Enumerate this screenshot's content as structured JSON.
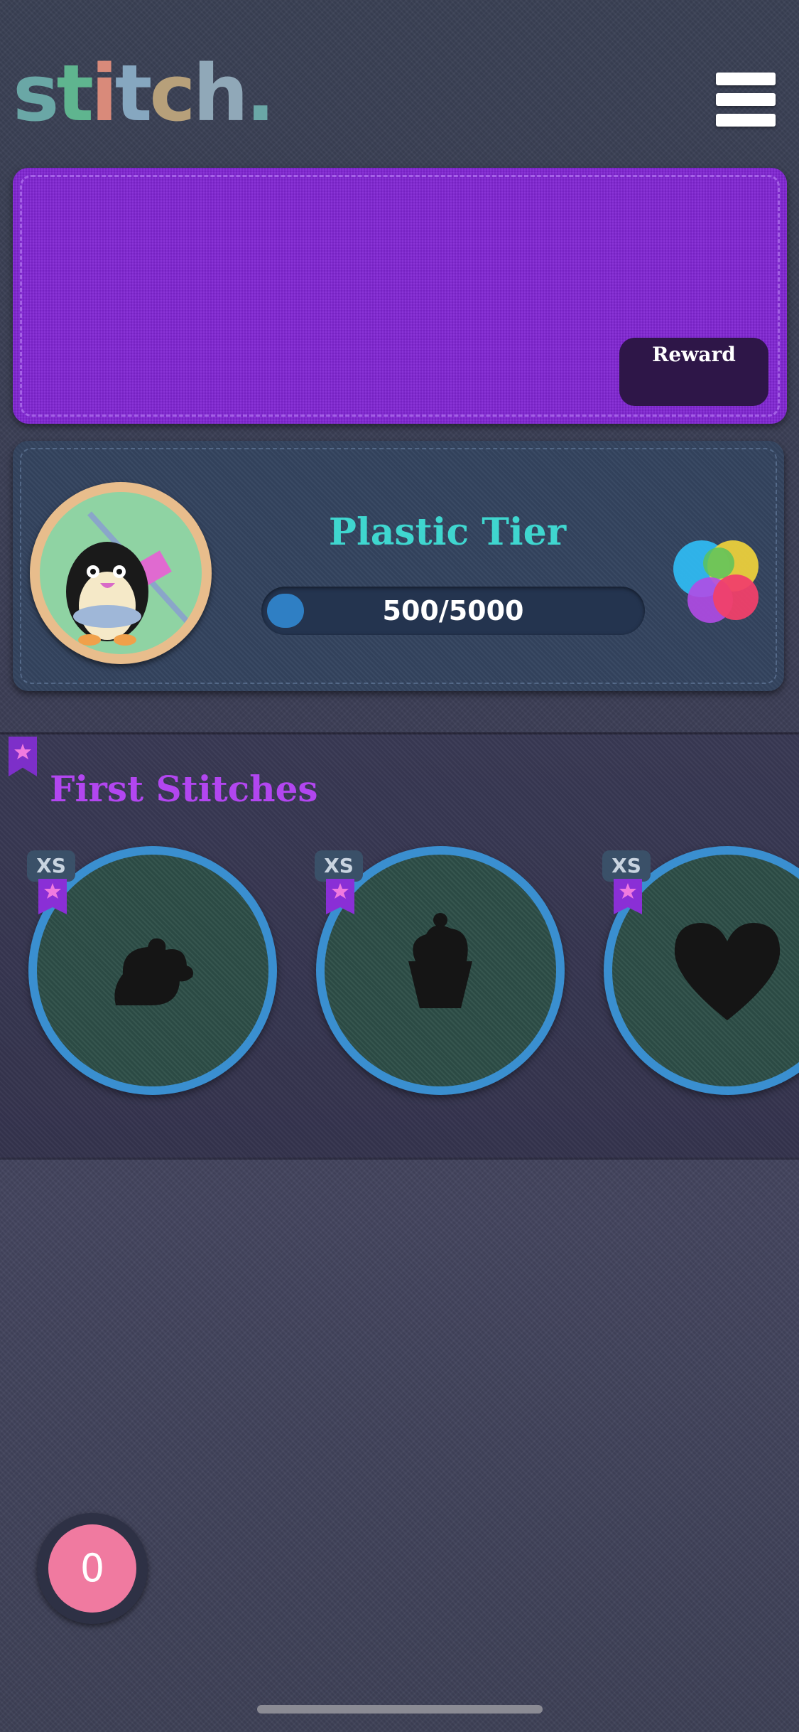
{
  "app": {
    "logo_text": "stitch.",
    "menu_icon": "hamburger-icon"
  },
  "banner": {
    "background_color": "#8125d4",
    "reward_label": "Reward"
  },
  "tier": {
    "title": "Plastic Tier",
    "progress_text": "500/5000",
    "progress_value": 500,
    "progress_max": 5000,
    "avatar_icon": "penguin-hoop-icon",
    "game_center_icon": "game-center-icon"
  },
  "section": {
    "title": "First Stitches",
    "badges": [
      {
        "size": "XS",
        "icon": "teapot-silhouette-icon"
      },
      {
        "size": "XS",
        "icon": "cupcake-silhouette-icon"
      },
      {
        "size": "XS",
        "icon": "heart-silhouette-icon"
      }
    ]
  },
  "coins": {
    "count": "0"
  },
  "colors": {
    "accent_teal": "#3fd6cf",
    "accent_purple": "#b246f0",
    "ring_blue": "#3a8fd0",
    "coin_pink": "#f07aa0"
  }
}
